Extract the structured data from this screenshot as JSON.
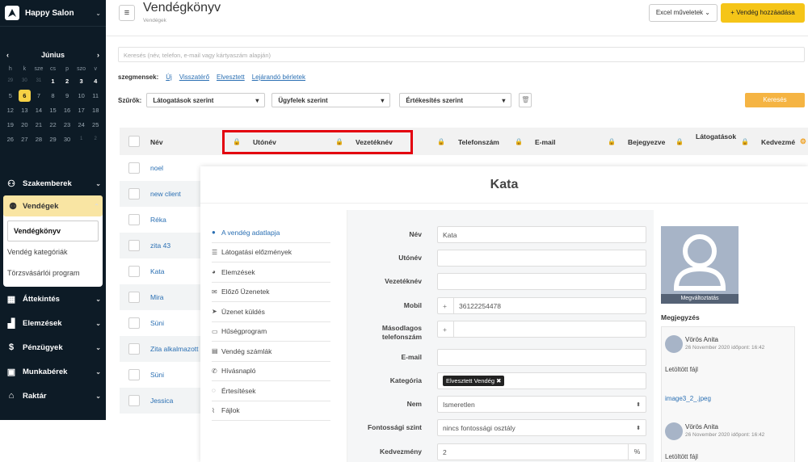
{
  "sidebar": {
    "brand": "Happy Salon",
    "calendar": {
      "month": "Június",
      "dow": [
        "h",
        "k",
        "sze",
        "cs",
        "p",
        "szo",
        "v"
      ],
      "weeks": [
        [
          {
            "d": "29",
            "m": true
          },
          {
            "d": "30",
            "m": true
          },
          {
            "d": "31",
            "m": true
          },
          {
            "d": "1"
          },
          {
            "d": "2"
          },
          {
            "d": "3"
          },
          {
            "d": "4"
          }
        ],
        [
          {
            "d": "5"
          },
          {
            "d": "6",
            "t": true
          },
          {
            "d": "7"
          },
          {
            "d": "8"
          },
          {
            "d": "9"
          },
          {
            "d": "10"
          },
          {
            "d": "11"
          }
        ],
        [
          {
            "d": "12"
          },
          {
            "d": "13"
          },
          {
            "d": "14"
          },
          {
            "d": "15"
          },
          {
            "d": "16"
          },
          {
            "d": "17"
          },
          {
            "d": "18"
          }
        ],
        [
          {
            "d": "19"
          },
          {
            "d": "20"
          },
          {
            "d": "21"
          },
          {
            "d": "22"
          },
          {
            "d": "23"
          },
          {
            "d": "24"
          },
          {
            "d": "25"
          }
        ],
        [
          {
            "d": "26"
          },
          {
            "d": "27"
          },
          {
            "d": "28"
          },
          {
            "d": "29"
          },
          {
            "d": "30"
          },
          {
            "d": "1",
            "m": true
          },
          {
            "d": "2",
            "m": true
          }
        ]
      ]
    },
    "menu": {
      "szakemberek": "Szakemberek",
      "vendegek": "Vendégek",
      "sub": [
        "Vendégkönyv",
        "Vendég kategóriák",
        "Törzsvásárlói program"
      ],
      "attekintes": "Áttekintés",
      "elemzesek": "Elemzések",
      "penzugyek": "Pénzügyek",
      "munkaberek": "Munkabérek",
      "raktar": "Raktár"
    }
  },
  "header": {
    "title": "Vendégkönyv",
    "breadcrumb": "Vendégek",
    "excel": "Excel műveletek",
    "add": "+ Vendég hozzáadása"
  },
  "search": {
    "placeholder": "Keresés (név, telefon, e-mail vagy kártyaszám alapján)"
  },
  "segments": {
    "label": "szegmensek:",
    "items": [
      "Új",
      "Visszatérő",
      "Elvesztett",
      "Lejárandó bérletek"
    ]
  },
  "filters": {
    "label": "Szűrők:",
    "items": [
      "Látogatások szerint",
      "Ügyfelek szerint",
      "Értékesítés szerint"
    ],
    "search_btn": "Keresés"
  },
  "table": {
    "headers": {
      "nev": "Név",
      "utonev": "Utónév",
      "vezeteknev": "Vezetéknév",
      "telefon": "Telefonszám",
      "email": "E-mail",
      "bejegyezve": "Bejegyezve",
      "latogatasok": "Látogatások",
      "kedvezmeny": "Kedvezmé"
    },
    "rows": [
      "noel",
      "new client",
      "Réka",
      "zita 43",
      "Kata",
      "Mira",
      "Süni",
      "Zita alkalmazott",
      "Süni",
      "Jessica"
    ]
  },
  "panel": {
    "title": "Kata",
    "nav": [
      "A vendég adatlapja",
      "Látogatási előzmények",
      "Elemzések",
      "Előző Üzenetek",
      "Üzenet küldés",
      "Hűségprogram",
      "Vendég számlák",
      "Hívásnapló",
      "Értesítések",
      "Fájlok"
    ],
    "fields": {
      "nev": {
        "label": "Név",
        "value": "Kata"
      },
      "utonev": {
        "label": "Utónév",
        "value": ""
      },
      "vezeteknev": {
        "label": "Vezetéknév",
        "value": ""
      },
      "mobil": {
        "label": "Mobil",
        "value": "36122254478",
        "prefix": "+"
      },
      "masodlagos": {
        "label1": "Másodlagos",
        "label2": "telefonszám",
        "prefix": "+"
      },
      "email": {
        "label": "E-mail",
        "value": ""
      },
      "kategoria": {
        "label": "Kategória",
        "tag": "Elvesztett Vendég ✖"
      },
      "nem": {
        "label": "Nem",
        "value": "Ismeretlen"
      },
      "fontossag": {
        "label": "Fontossági szint",
        "value": "nincs fontossági osztály"
      },
      "kedvezmeny": {
        "label": "Kedvezmény",
        "value": "2",
        "unit": "%"
      }
    },
    "avatar_btn": "Megváltoztatás",
    "notes_title": "Megjegyzés",
    "notes": [
      {
        "name": "Vörös Anita",
        "date": "26 November 2020 időpont: 16:42",
        "text": "Letöltött fájl"
      },
      {
        "name": "Vörös Anita",
        "date": "26 November 2020 időpont: 16:42",
        "text": "Letöltött fájl"
      }
    ],
    "note_link": "image3_2_.jpeg"
  }
}
